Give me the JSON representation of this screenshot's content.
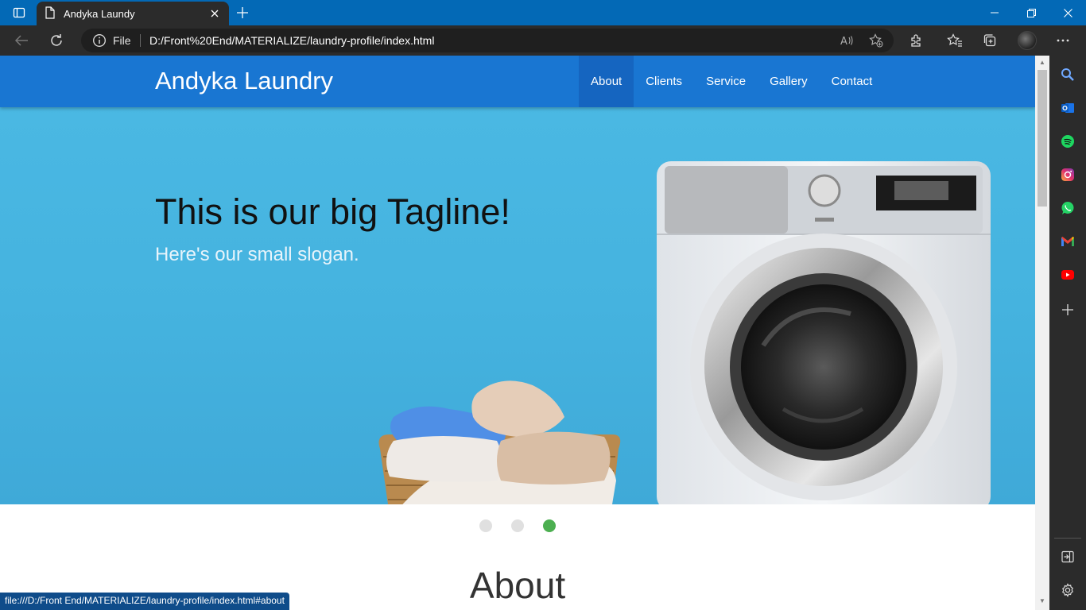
{
  "browser": {
    "tab_title": "Andyka Laundy",
    "address_scheme": "File",
    "address_url": "D:/Front%20End/MATERIALIZE/laundry-profile/index.html",
    "status_url": "file:///D:/Front End/MATERIALIZE/laundry-profile/index.html#about"
  },
  "site": {
    "brand": "Andyka Laundry",
    "nav": [
      {
        "label": "About",
        "active": true
      },
      {
        "label": "Clients"
      },
      {
        "label": "Service"
      },
      {
        "label": "Gallery"
      },
      {
        "label": "Contact"
      }
    ],
    "hero": {
      "tagline": "This is our big Tagline!",
      "slogan": "Here's our small slogan."
    },
    "carousel": {
      "slides": 3,
      "active_index": 2
    },
    "section_title": "About"
  },
  "colors": {
    "nav": "#1976d2",
    "nav_active": "#1565c0",
    "hero_bg": "#45b3df",
    "indicator_active": "#4caf50"
  },
  "sidebar_icons": [
    "search-icon",
    "outlook-icon",
    "spotify-icon",
    "instagram-icon",
    "whatsapp-icon",
    "gmail-icon",
    "youtube-icon",
    "add-icon",
    "hide-sidebar-icon",
    "settings-icon"
  ]
}
